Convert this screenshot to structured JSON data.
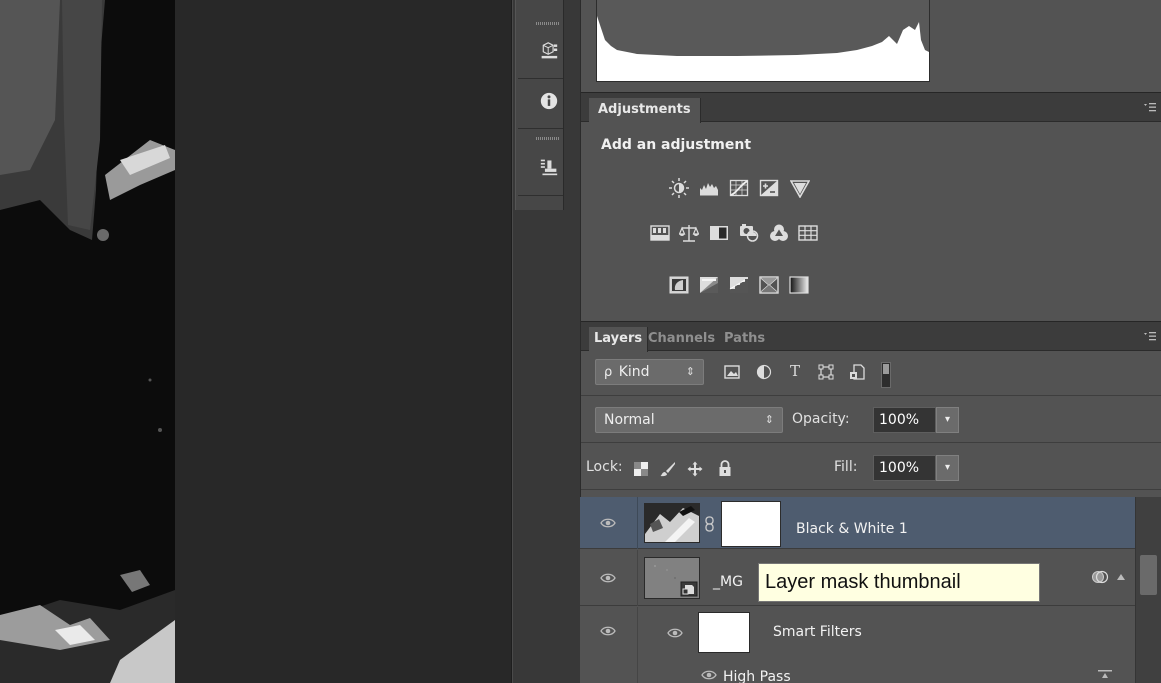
{
  "adjustments": {
    "tab_label": "Adjustments",
    "heading": "Add an adjustment",
    "icon_rows": [
      [
        "brightness-contrast-icon",
        "levels-icon",
        "curves-icon",
        "exposure-icon",
        "vibrance-icon"
      ],
      [
        "hue-saturation-icon",
        "color-balance-icon",
        "black-white-icon",
        "photo-filter-icon",
        "channel-mixer-icon",
        "color-lookup-icon"
      ],
      [
        "invert-icon",
        "posterize-icon",
        "threshold-icon",
        "selective-color-icon",
        "gradient-map-icon"
      ]
    ]
  },
  "layers_panel": {
    "tabs": [
      "Layers",
      "Channels",
      "Paths"
    ],
    "active_tab": "Layers",
    "filter_kind": "Kind",
    "filter_search_glyph": "ρ",
    "blend_mode": "Normal",
    "opacity_label": "Opacity:",
    "opacity_value": "100%",
    "lock_label": "Lock:",
    "fill_label": "Fill:",
    "fill_value": "100%",
    "updown_glyph": "⇕",
    "dropdown_glyph": "▾",
    "layers": [
      {
        "name": "Black & White 1",
        "visible": true,
        "selected": true
      },
      {
        "name": "_MG",
        "visible": true,
        "selected": false
      },
      {
        "name": "Smart Filters",
        "visible": true,
        "selected": false
      },
      {
        "name": "High Pass",
        "visible": true,
        "selected": false
      }
    ]
  },
  "tooltip": {
    "text": "Layer mask thumbnail"
  },
  "colors": {
    "panel_bg": "#535353",
    "selected_layer_bg": "#4e5c6f",
    "tooltip_bg": "#ffffe1"
  }
}
